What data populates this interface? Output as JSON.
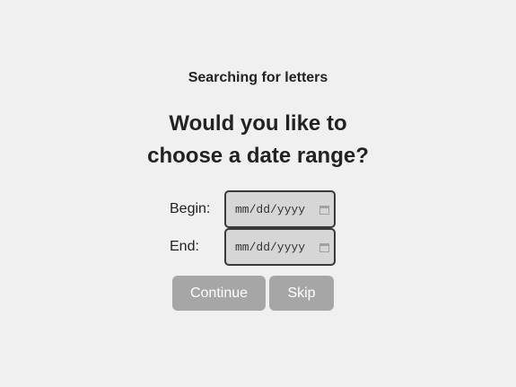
{
  "header": {
    "subtitle": "Searching for letters",
    "question_line1": "Would you like to",
    "question_line2": "choose a date range?"
  },
  "form": {
    "begin_label": "Begin:",
    "begin_placeholder": "mm/dd/yyyy",
    "end_label": "End:",
    "end_placeholder": "mm/dd/yyyy",
    "calendar_icon": "calendar-icon"
  },
  "actions": {
    "continue_label": "Continue",
    "skip_label": "Skip"
  },
  "colors": {
    "background": "#f0f0f0",
    "button": "#a6a6a6",
    "input_bg": "#d6d6d6"
  }
}
